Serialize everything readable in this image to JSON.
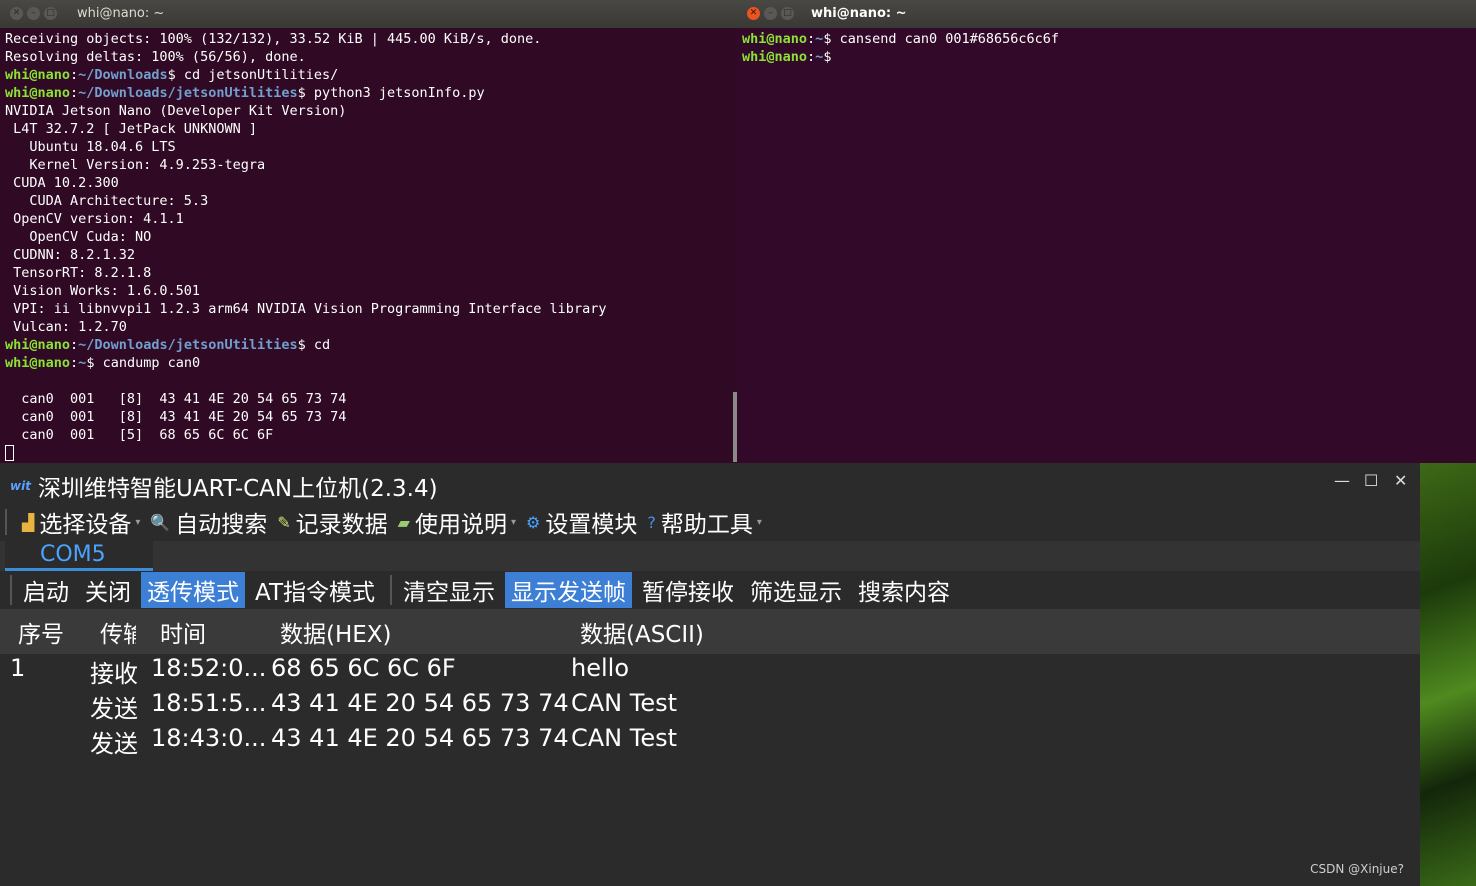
{
  "left_terminal": {
    "title": "whi@nano: ~",
    "lines": [
      {
        "type": "text",
        "text": "Receiving objects: 100% (132/132), 33.52 KiB | 445.00 KiB/s, done."
      },
      {
        "type": "text",
        "text": "Resolving deltas: 100% (56/56), done."
      },
      {
        "type": "prompt",
        "user": "whi@nano",
        "path": "~/Downloads",
        "cmd": " cd jetsonUtilities/"
      },
      {
        "type": "prompt",
        "user": "whi@nano",
        "path": "~/Downloads/jetsonUtilities",
        "cmd": " python3 jetsonInfo.py"
      },
      {
        "type": "text",
        "text": "NVIDIA Jetson Nano (Developer Kit Version)"
      },
      {
        "type": "text",
        "text": " L4T 32.7.2 [ JetPack UNKNOWN ]"
      },
      {
        "type": "text",
        "text": "   Ubuntu 18.04.6 LTS"
      },
      {
        "type": "text",
        "text": "   Kernel Version: 4.9.253-tegra"
      },
      {
        "type": "text",
        "text": " CUDA 10.2.300"
      },
      {
        "type": "text",
        "text": "   CUDA Architecture: 5.3"
      },
      {
        "type": "text",
        "text": " OpenCV version: 4.1.1"
      },
      {
        "type": "text",
        "text": "   OpenCV Cuda: NO"
      },
      {
        "type": "text",
        "text": " CUDNN: 8.2.1.32"
      },
      {
        "type": "text",
        "text": " TensorRT: 8.2.1.8"
      },
      {
        "type": "text",
        "text": " Vision Works: 1.6.0.501"
      },
      {
        "type": "text",
        "text": " VPI: ii libnvvpi1 1.2.3 arm64 NVIDIA Vision Programming Interface library"
      },
      {
        "type": "text",
        "text": " Vulcan: 1.2.70"
      },
      {
        "type": "prompt",
        "user": "whi@nano",
        "path": "~/Downloads/jetsonUtilities",
        "cmd": " cd"
      },
      {
        "type": "prompt",
        "user": "whi@nano",
        "path": "~",
        "cmd": " candump can0"
      },
      {
        "type": "text",
        "text": ""
      },
      {
        "type": "text",
        "text": "  can0  001   [8]  43 41 4E 20 54 65 73 74"
      },
      {
        "type": "text",
        "text": "  can0  001   [8]  43 41 4E 20 54 65 73 74"
      },
      {
        "type": "text",
        "text": "  can0  001   [5]  68 65 6C 6C 6F"
      },
      {
        "type": "cursor"
      }
    ]
  },
  "right_terminal": {
    "title": "whi@nano: ~",
    "lines": [
      {
        "type": "prompt",
        "user": "whi@nano",
        "path": "~",
        "cmd": " cansend can0 001#68656c6c6f"
      },
      {
        "type": "prompt",
        "user": "whi@nano",
        "path": "~",
        "cmd": ""
      }
    ]
  },
  "app": {
    "title": "深圳维特智能UART-CAN上位机(2.3.4)",
    "logo": "wit",
    "window_controls": {
      "minimize": "—",
      "maximize": "☐",
      "close": "✕"
    },
    "menu": [
      {
        "label": "选择设备",
        "icon": "device-icon",
        "glyph": "▟",
        "caret": true
      },
      {
        "label": "自动搜索",
        "icon": "magnifier-icon",
        "glyph": "🔍",
        "caret": false
      },
      {
        "label": "记录数据",
        "icon": "pencil-icon",
        "glyph": "✎",
        "caret": false
      },
      {
        "label": "使用说明",
        "icon": "book-icon",
        "glyph": "▰",
        "caret": true
      },
      {
        "label": "设置模块",
        "icon": "gear-icon",
        "glyph": "⚙",
        "caret": false
      },
      {
        "label": "帮助工具",
        "icon": "help-icon",
        "glyph": "?",
        "caret": true
      }
    ],
    "tab": "COM5",
    "actions": [
      "启动",
      "关闭",
      "透传模式",
      "AT指令模式",
      "清空显示",
      "显示发送帧",
      "暂停接收",
      "筛选显示",
      "搜索内容"
    ],
    "active_actions": [
      "透传模式",
      "显示发送帧"
    ],
    "table": {
      "headers": [
        "序号",
        "传输",
        "时间",
        "数据(HEX)",
        "数据(ASCII)"
      ],
      "rows": [
        [
          "1",
          "接收",
          "18:52:0...",
          "68 65 6C 6C 6F",
          "hello"
        ],
        [
          "",
          "发送",
          "18:51:5...",
          "43 41 4E 20 54 65 73 74",
          "CAN Test"
        ],
        [
          "",
          "发送",
          "18:43:0...",
          "43 41 4E 20 54 65 73 74",
          "CAN Test"
        ]
      ]
    }
  },
  "watermark": "CSDN @Xinjue?"
}
